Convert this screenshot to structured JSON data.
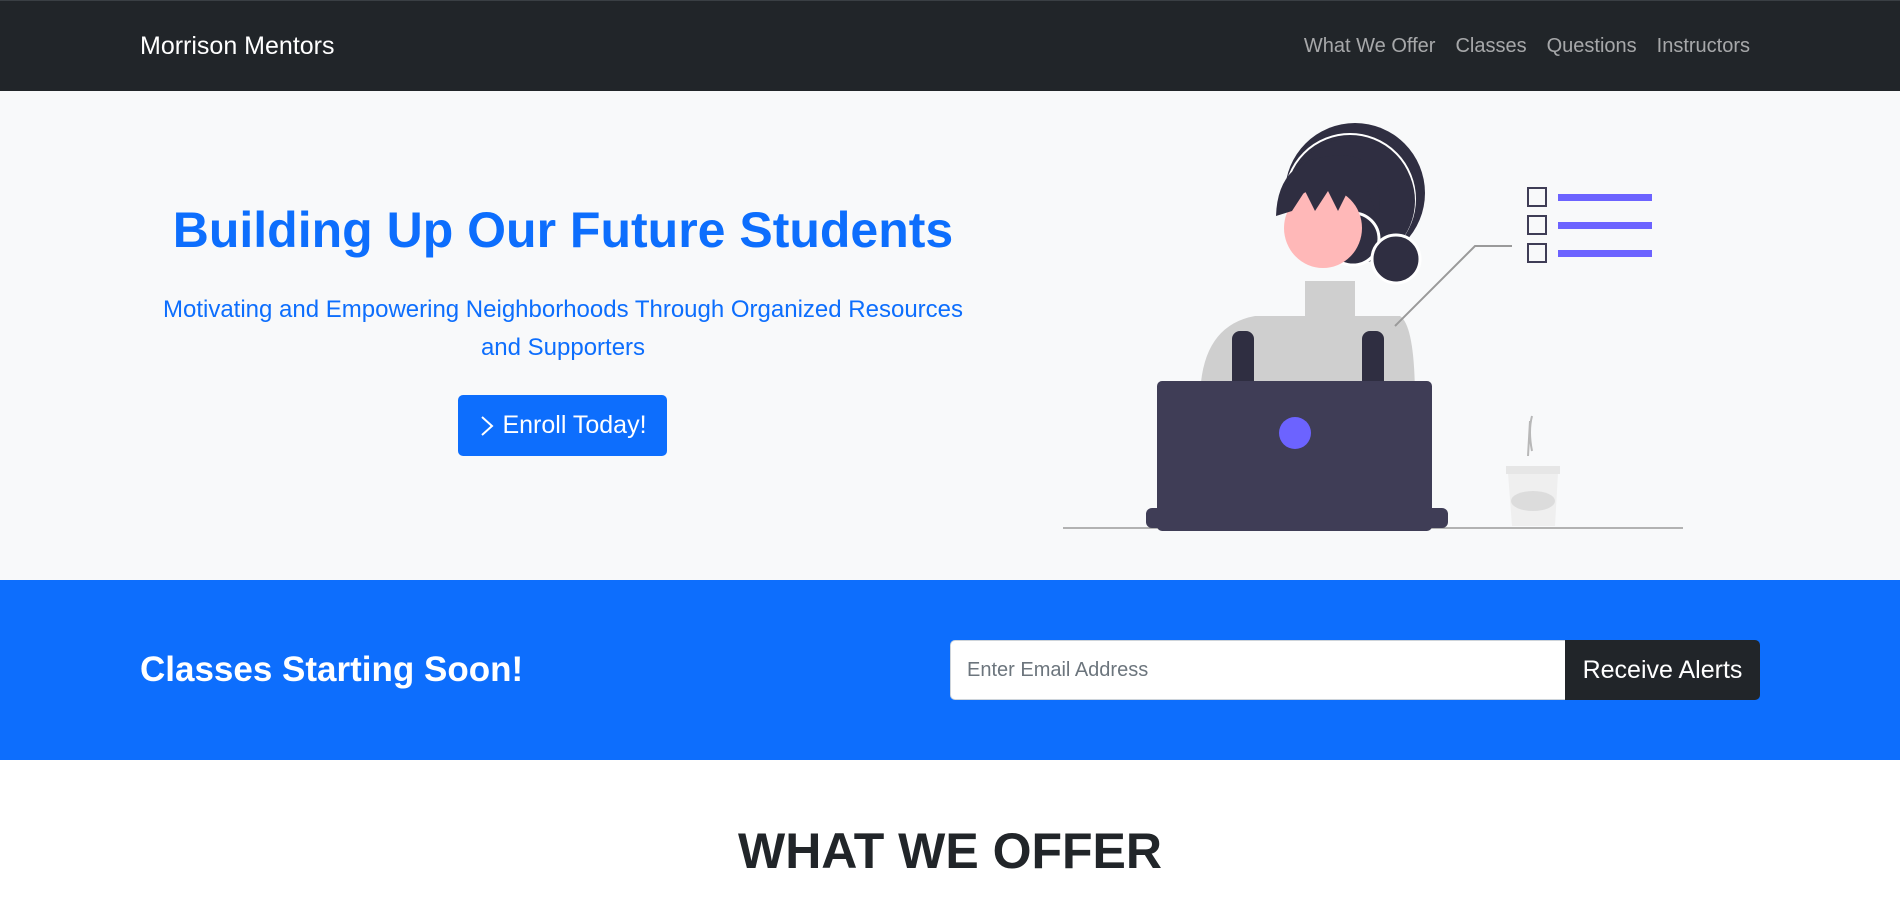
{
  "navbar": {
    "brand": "Morrison Mentors",
    "links": [
      "What We Offer",
      "Classes",
      "Questions",
      "Instructors"
    ]
  },
  "hero": {
    "title": "Building Up Our Future Students",
    "subtitle": "Motivating and Empowering Neighborhoods Through Organized Resources and Supporters",
    "button_label": "Enroll Today!",
    "button_icon": "chevron-right-icon",
    "illustration": "woman-at-laptop-illustration"
  },
  "newsletter": {
    "title": "Classes Starting Soon!",
    "email_placeholder": "Enter Email Address",
    "email_value": "",
    "button_label": "Receive Alerts"
  },
  "offer": {
    "title": "WHAT WE OFFER"
  },
  "colors": {
    "primary": "#0d6efd",
    "dark": "#212529",
    "light": "#f8f9fa",
    "illustration_accent": "#6c63ff",
    "illustration_dark": "#3f3d56"
  }
}
